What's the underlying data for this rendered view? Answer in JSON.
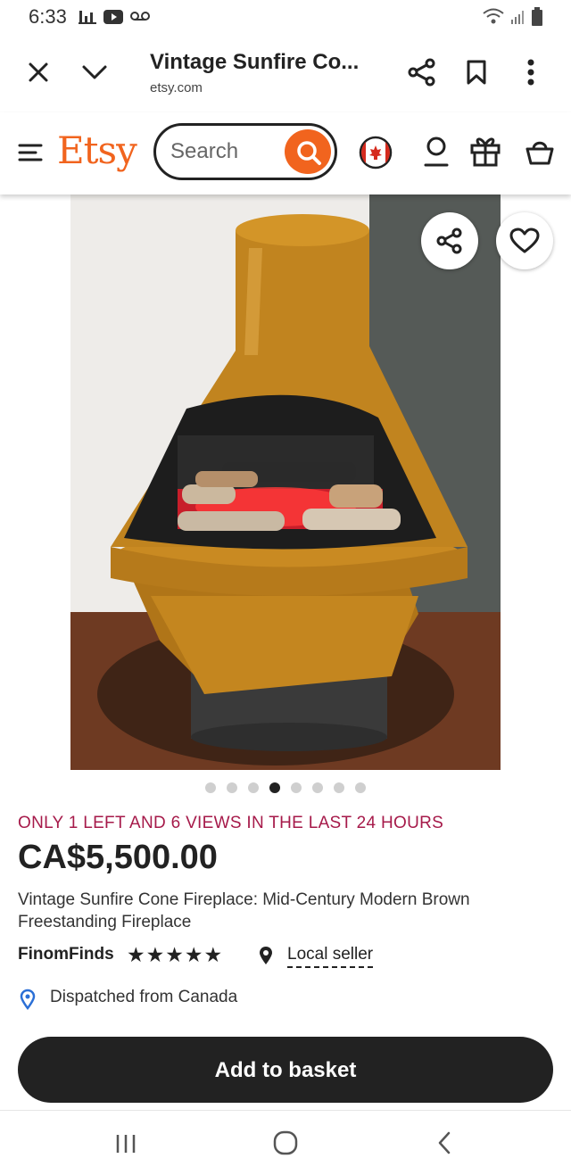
{
  "status_bar": {
    "time": "6:33",
    "icons": [
      "signal-bars-icon",
      "youtube-icon",
      "voicemail-icon",
      "wifi-icon",
      "cell-signal-icon",
      "battery-icon"
    ]
  },
  "browser": {
    "title": "Vintage Sunfire Co...",
    "url": "etsy.com",
    "icons": [
      "close-icon",
      "chevron-down-icon",
      "share-icon",
      "bookmark-icon",
      "more-vert-icon"
    ]
  },
  "header": {
    "logo": "Etsy",
    "search_placeholder": "Search",
    "icons": [
      "menu-icon",
      "search-icon",
      "canada-flag-icon",
      "account-icon",
      "gift-icon",
      "basket-icon"
    ]
  },
  "product": {
    "image_icons": [
      "share-icon",
      "heart-icon"
    ],
    "carousel": {
      "total": 8,
      "active": 4
    },
    "urgency": "ONLY 1 LEFT AND 6 VIEWS IN THE LAST 24 HOURS",
    "price": "CA$5,500.00",
    "title": "Vintage Sunfire Cone Fireplace: Mid-Century Modern Brown Freestanding Fireplace",
    "shop_name": "FinomFinds",
    "rating_stars": "★★★★★",
    "rating": 5,
    "local_seller": "Local seller",
    "dispatch": "Dispatched from Canada",
    "add_to_basket": "Add to basket"
  },
  "colors": {
    "accent": "#f1641e",
    "urgency": "#a61a4a",
    "button": "#222222"
  },
  "nav": {
    "icons": [
      "recents-icon",
      "home-icon",
      "back-icon"
    ]
  }
}
